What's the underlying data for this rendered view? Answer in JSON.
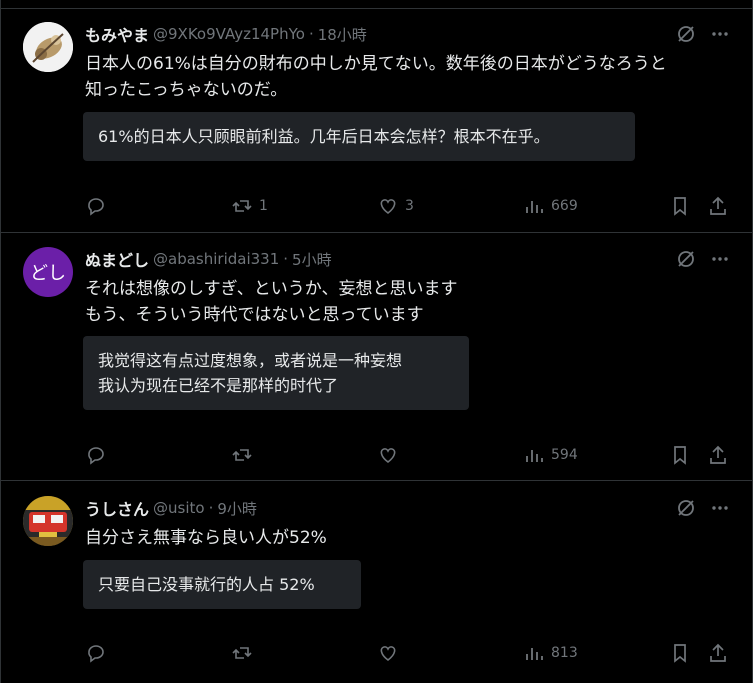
{
  "tweets": [
    {
      "name": "もみやま",
      "handle": "@9XKo9VAyz14PhYo",
      "dot": "·",
      "time": "18小時",
      "text": "日本人の61%は自分の財布の中しか見てない。数年後の日本がどうなろうと\n知ったこっちゃないのだ。",
      "translation": "61%的日本人只顾眼前利益。几年后日本会怎样？根本不在乎。",
      "stats": {
        "replies": "",
        "retweets": "1",
        "likes": "3",
        "views": "669"
      },
      "avatar": {
        "type": "image",
        "bg": "#f2f2f2"
      }
    },
    {
      "name": "ぬまどし",
      "handle": "@abashiridai331",
      "dot": "·",
      "time": "5小時",
      "text": "それは想像のしすぎ、というか、妄想と思います\nもう、そういう時代ではないと思っています",
      "translation": "我觉得这有点过度想象，或者说是一种妄想\n我认为现在已经不是那样的时代了",
      "stats": {
        "replies": "",
        "retweets": "",
        "likes": "",
        "views": "594"
      },
      "avatar": {
        "type": "text",
        "label": "どし",
        "bg": "#6b1fa8"
      }
    },
    {
      "name": "うしさん",
      "handle": "@usito",
      "dot": "·",
      "time": "9小時",
      "text": "自分さえ無事なら良い人が52%",
      "translation": "只要自己没事就行的人占 52%",
      "stats": {
        "replies": "",
        "retweets": "",
        "likes": "",
        "views": "813"
      },
      "avatar": {
        "type": "image",
        "bg": "#c9a227"
      }
    }
  ],
  "icons": {
    "reply": "reply-icon",
    "retweet": "retweet-icon",
    "like": "heart-icon",
    "views": "views-icon",
    "bookmark": "bookmark-icon",
    "share": "share-icon",
    "grok": "grok-icon",
    "more": "more-icon"
  },
  "colors": {
    "background": "#000000",
    "text": "#e7e9ea",
    "muted": "#71767b",
    "border": "#2f3336",
    "translation_bg": "#202327"
  }
}
